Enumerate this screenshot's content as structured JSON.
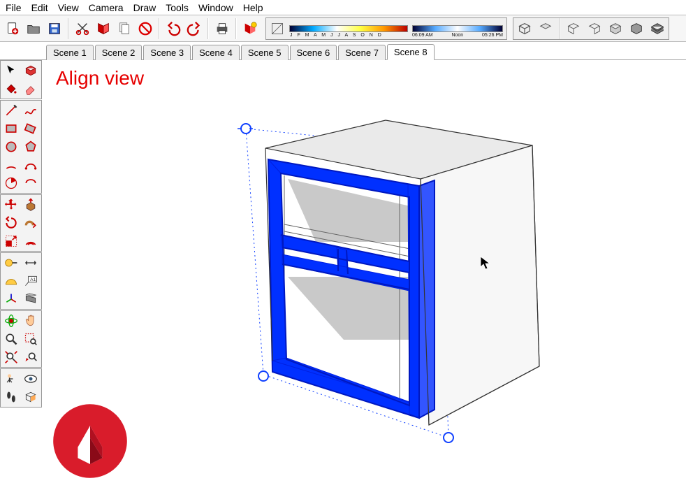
{
  "menu": {
    "items": [
      "File",
      "Edit",
      "View",
      "Camera",
      "Draw",
      "Tools",
      "Window",
      "Help"
    ]
  },
  "toolbar": {
    "new": "new-file-icon",
    "open": "open-file-icon",
    "save": "save-icon",
    "cut": "cut-icon",
    "delete_red": "delete-icon",
    "copy": "copy-icon",
    "cancel": "cancel-icon",
    "undo": "undo-icon",
    "redo": "redo-icon",
    "print": "print-icon",
    "model_info": "model-info-icon"
  },
  "shadow_panel": {
    "months": "J F M A M J J A S O N D",
    "time_start": "06:09 AM",
    "time_mid": "Noon",
    "time_end": "05:26 PM"
  },
  "views": {
    "items": [
      "iso",
      "top",
      "front",
      "right",
      "back",
      "left",
      "iso2"
    ]
  },
  "scenes": {
    "tabs": [
      {
        "label": "Scene 1",
        "active": false
      },
      {
        "label": "Scene 2",
        "active": false
      },
      {
        "label": "Scene 3",
        "active": false
      },
      {
        "label": "Scene 4",
        "active": false
      },
      {
        "label": "Scene 5",
        "active": false
      },
      {
        "label": "Scene 6",
        "active": false
      },
      {
        "label": "Scene 7",
        "active": false
      },
      {
        "label": "Scene 8",
        "active": true
      }
    ]
  },
  "canvas": {
    "label": "Align view"
  },
  "left_tools": {
    "groups": [
      [
        "select-icon",
        "make-component-icon",
        "paint-bucket-icon",
        "eraser-icon"
      ],
      [
        "line-icon",
        "freehand-icon",
        "rectangle-icon",
        "rotated-rect-icon",
        "circle-icon",
        "polygon-icon",
        "arc-icon",
        "arc2-icon",
        "pie-icon",
        "bezier-icon"
      ],
      [
        "move-icon",
        "pushpull-icon",
        "rotate-icon",
        "followme-icon",
        "scale-icon",
        "offset-icon"
      ],
      [
        "tape-icon",
        "dimension-icon",
        "protractor-icon",
        "text-icon",
        "axes-icon",
        "section-icon"
      ],
      [
        "orbit-icon",
        "pan-icon",
        "zoom-icon",
        "zoom-window-icon",
        "zoom-extents-icon",
        "previous-icon"
      ],
      [
        "position-camera-icon",
        "look-around-icon",
        "walk-icon",
        "section-display-icon"
      ]
    ]
  }
}
